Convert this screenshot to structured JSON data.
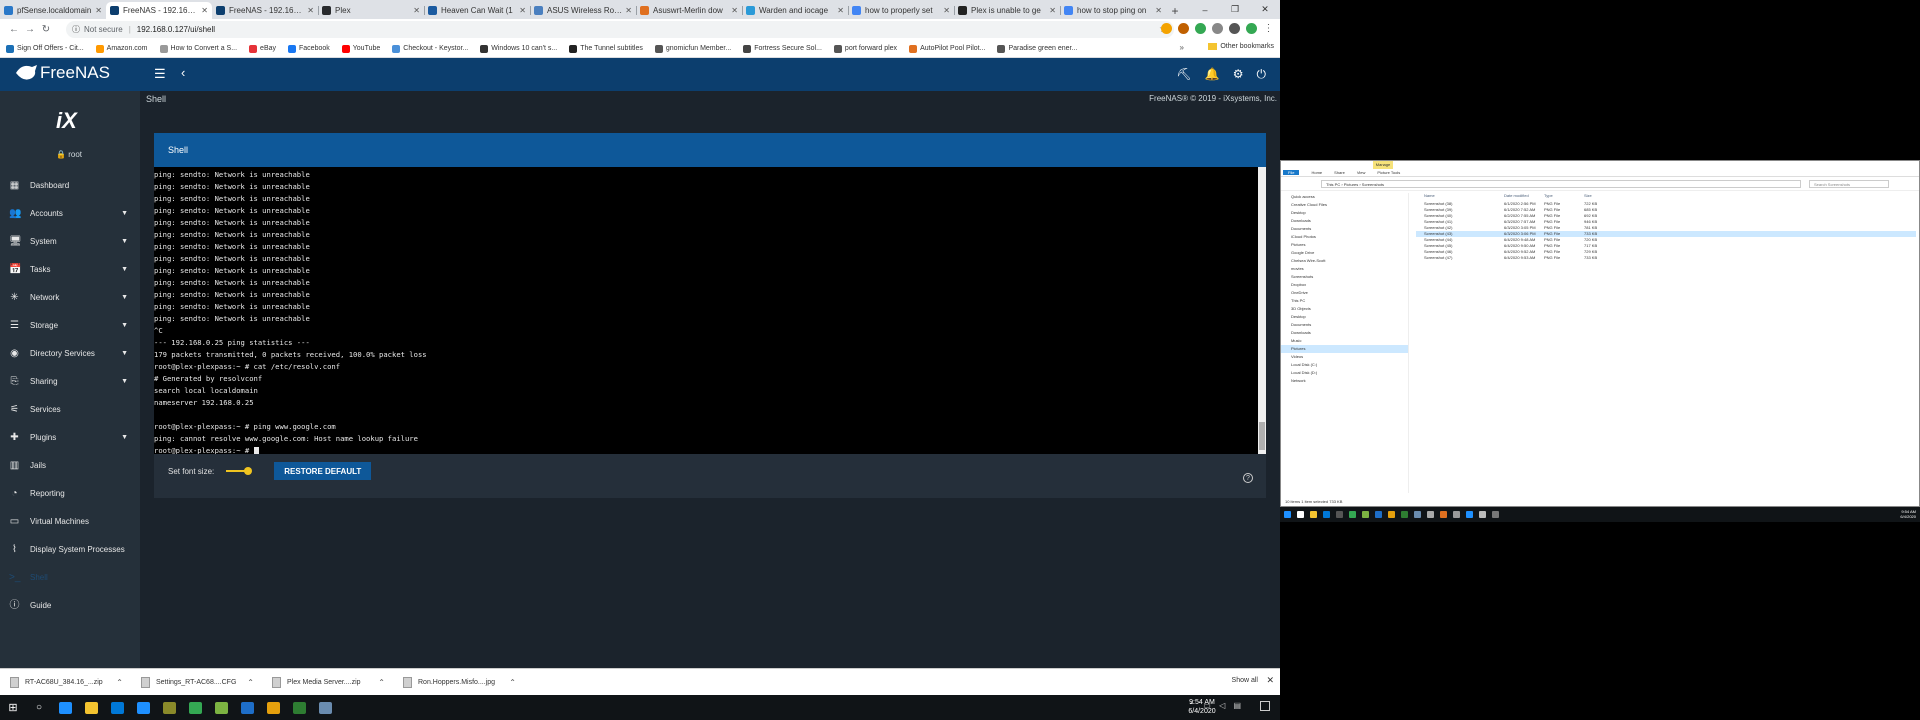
{
  "browser": {
    "tabs": [
      {
        "title": "pfSense.localdomain",
        "color": "#2a78c8"
      },
      {
        "title": "FreeNAS - 192.168.0",
        "color": "#0c3e6e",
        "active": true
      },
      {
        "title": "FreeNAS - 192.168.0",
        "color": "#0c3e6e"
      },
      {
        "title": "Plex",
        "color": "#282a2d"
      },
      {
        "title": "Heaven Can Wait (1",
        "color": "#1a5aa0"
      },
      {
        "title": "ASUS Wireless Route",
        "color": "#4a7fbf"
      },
      {
        "title": "Asuswrt-Merlin dow",
        "color": "#e07020"
      },
      {
        "title": "Warden and iocage",
        "color": "#2a9ad8"
      },
      {
        "title": "how to properly set",
        "color": "#4285f4"
      },
      {
        "title": "Plex is unable to ge",
        "color": "#222222"
      },
      {
        "title": "how to stop ping on",
        "color": "#4285f4"
      }
    ],
    "new_tab": "+",
    "window_controls": [
      "–",
      "❐",
      "✕"
    ],
    "address": {
      "security": "Not secure",
      "url": "192.168.0.127/ui/shell"
    },
    "bookmarks": [
      {
        "label": "Sign Off Offers - Cit...",
        "color": "#1b6fb5"
      },
      {
        "label": "Amazon.com",
        "color": "#ff9900"
      },
      {
        "label": "How to Convert a S...",
        "color": "#999999"
      },
      {
        "label": "eBay",
        "color": "#e53238"
      },
      {
        "label": "Facebook",
        "color": "#1877f2"
      },
      {
        "label": "YouTube",
        "color": "#ff0000"
      },
      {
        "label": "Checkout - Keystor...",
        "color": "#4a90d9"
      },
      {
        "label": "Windows 10 can't s...",
        "color": "#333333"
      },
      {
        "label": "The Tunnel subtitles",
        "color": "#222222"
      },
      {
        "label": "gnomicfun Member...",
        "color": "#555555"
      },
      {
        "label": "Fortress Secure Sol...",
        "color": "#444444"
      },
      {
        "label": "port forward plex",
        "color": "#555555"
      },
      {
        "label": "AutoPilot Pool Pilot...",
        "color": "#e07020"
      },
      {
        "label": "Paradise green ener...",
        "color": "#555555"
      }
    ],
    "bookmarks_more": "»",
    "other_bookmarks": "Other bookmarks"
  },
  "freenas": {
    "logo": "FreeNAS",
    "breadcrumb": "Shell",
    "copyright": "FreeNAS® © 2019 - iXsystems, Inc.",
    "user": "root",
    "avatar_text": "iX",
    "nav": [
      {
        "label": "Dashboard",
        "icon": "dashboard-icon",
        "glyph": "▦",
        "caret": false
      },
      {
        "label": "Accounts",
        "icon": "accounts-icon",
        "glyph": "👥",
        "caret": true
      },
      {
        "label": "System",
        "icon": "system-icon",
        "glyph": "🖥",
        "caret": true
      },
      {
        "label": "Tasks",
        "icon": "tasks-icon",
        "glyph": "📅",
        "caret": true
      },
      {
        "label": "Network",
        "icon": "network-icon",
        "glyph": "✳",
        "caret": true
      },
      {
        "label": "Storage",
        "icon": "storage-icon",
        "glyph": "☰",
        "caret": true
      },
      {
        "label": "Directory Services",
        "icon": "directory-services-icon",
        "glyph": "◉",
        "caret": true
      },
      {
        "label": "Sharing",
        "icon": "sharing-icon",
        "glyph": "⎘",
        "caret": true
      },
      {
        "label": "Services",
        "icon": "services-icon",
        "glyph": "⚟",
        "caret": false
      },
      {
        "label": "Plugins",
        "icon": "plugins-icon",
        "glyph": "✚",
        "caret": true
      },
      {
        "label": "Jails",
        "icon": "jails-icon",
        "glyph": "▥",
        "caret": false
      },
      {
        "label": "Reporting",
        "icon": "reporting-icon",
        "glyph": "◔",
        "caret": false
      },
      {
        "label": "Virtual Machines",
        "icon": "virtual-machines-icon",
        "glyph": "▭",
        "caret": false
      },
      {
        "label": "Display System Processes",
        "icon": "processes-icon",
        "glyph": "⌇",
        "caret": false
      },
      {
        "label": "Shell",
        "icon": "shell-icon",
        "glyph": ">_",
        "caret": false,
        "active": true
      },
      {
        "label": "Guide",
        "icon": "guide-icon",
        "glyph": "ⓘ",
        "caret": false
      }
    ],
    "shell": {
      "title": "Shell",
      "lines": [
        "ping: sendto: Network is unreachable",
        "ping: sendto: Network is unreachable",
        "ping: sendto: Network is unreachable",
        "ping: sendto: Network is unreachable",
        "ping: sendto: Network is unreachable",
        "ping: sendto: Network is unreachable",
        "ping: sendto: Network is unreachable",
        "ping: sendto: Network is unreachable",
        "ping: sendto: Network is unreachable",
        "ping: sendto: Network is unreachable",
        "ping: sendto: Network is unreachable",
        "ping: sendto: Network is unreachable",
        "ping: sendto: Network is unreachable",
        "^C",
        "--- 192.168.0.25 ping statistics ---",
        "179 packets transmitted, 0 packets received, 100.0% packet loss",
        "root@plex-plexpass:~ # cat /etc/resolv.conf",
        "# Generated by resolvconf",
        "search local localdomain",
        "nameserver 192.168.0.25",
        "",
        "root@plex-plexpass:~ # ping www.google.com",
        "ping: cannot resolve www.google.com: Host name lookup failure"
      ],
      "prompt": "root@plex-plexpass:~ # ",
      "font_size_label": "Set font size:",
      "font_size_level": 0.65,
      "restore_label": "RESTORE DEFAULT"
    }
  },
  "downloads": {
    "items": [
      {
        "name": "RT-AC68U_384.16_...zip"
      },
      {
        "name": "Settings_RT-AC68....CFG"
      },
      {
        "name": "Plex Media Server....zip"
      },
      {
        "name": "Ron.Hoppers.Misfo....jpg"
      }
    ],
    "show_all": "Show all"
  },
  "taskbar": {
    "apps": [
      "#1e90ff",
      "#f4c430",
      "#0078d7",
      "#1e90ff",
      "#8a8a2a",
      "#34a853",
      "#7cb342",
      "#1e6ec8",
      "#e5a00d",
      "#2e7d32",
      "#6a8caf"
    ],
    "time": "9:54 AM",
    "date": "6/4/2020"
  },
  "explorer": {
    "tabs": [
      "File",
      "Home",
      "Share",
      "View",
      "Picture Tools"
    ],
    "manage": "Manage",
    "address": "This PC › Pictures › Screenshots",
    "search": "Search Screenshots",
    "tree": [
      "Quick access",
      "Creative Cloud Files",
      "Desktop",
      "Downloads",
      "Documents",
      "iCloud Photos",
      "Pictures",
      "Google Drive",
      "Chelsea Wire-Scott",
      "movies",
      "Screenshots",
      "Dropbox",
      "OneDrive",
      "This PC",
      "3D Objects",
      "Desktop",
      "Documents",
      "Downloads",
      "Music",
      "Pictures",
      "Videos",
      "Local Disk (C:)",
      "Local Disk (D:)",
      "Network"
    ],
    "tree_selected": 19,
    "headers": [
      "Name",
      "Date modified",
      "Type",
      "Size"
    ],
    "files": [
      {
        "name": "Screenshot (38)",
        "date": "6/1/2020 2:56 PM",
        "type": "PNG File",
        "size": "722 KB"
      },
      {
        "name": "Screenshot (39)",
        "date": "6/1/2020 7:52 AM",
        "type": "PNG File",
        "size": "685 KB"
      },
      {
        "name": "Screenshot (40)",
        "date": "6/2/2020 7:55 AM",
        "type": "PNG File",
        "size": "692 KB"
      },
      {
        "name": "Screenshot (41)",
        "date": "6/3/2020 7:57 AM",
        "type": "PNG File",
        "size": "946 KB"
      },
      {
        "name": "Screenshot (42)",
        "date": "6/3/2020 3:05 PM",
        "type": "PNG File",
        "size": "781 KB"
      },
      {
        "name": "Screenshot (43)",
        "date": "6/3/2020 3:06 PM",
        "type": "PNG File",
        "size": "733 KB"
      },
      {
        "name": "Screenshot (44)",
        "date": "6/4/2020 9:48 AM",
        "type": "PNG File",
        "size": "720 KB"
      },
      {
        "name": "Screenshot (45)",
        "date": "6/4/2020 9:50 AM",
        "type": "PNG File",
        "size": "717 KB"
      },
      {
        "name": "Screenshot (46)",
        "date": "6/4/2020 9:52 AM",
        "type": "PNG File",
        "size": "729 KB"
      },
      {
        "name": "Screenshot (47)",
        "date": "6/4/2020 9:53 AM",
        "type": "PNG File",
        "size": "733 KB"
      }
    ],
    "file_selected": 5,
    "status": "10 items     1 item selected  733 KB"
  }
}
